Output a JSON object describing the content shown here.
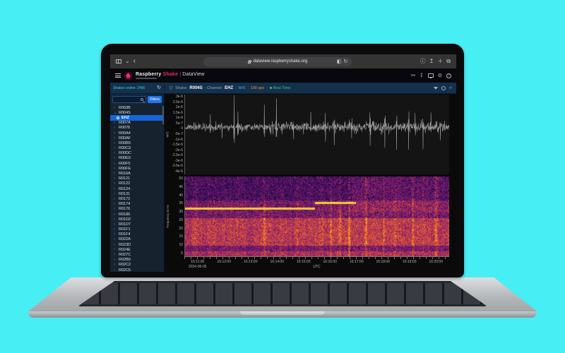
{
  "colors": {
    "background": "#47eef4",
    "accent_blue": "#2574e8",
    "cyan": "#35d0e8",
    "orange": "#f0953a",
    "green": "#2fd27d",
    "magenta": "#e8286e",
    "selection": "#1565d8",
    "waveform": "#9c9c9c"
  },
  "browser": {
    "url": "dataview.raspberryshake.org"
  },
  "header": {
    "brand_a": "Raspberry",
    "brand_b": "Shake",
    "sep": "|",
    "product": "DataView"
  },
  "toolbar": {
    "shakes_online": "Shakes online: 2466",
    "station_prefix": "Shake:",
    "station": "R004S",
    "channel_prefix": "- Channel:",
    "channel": "EHZ",
    "units": "M/S",
    "sps": "100 sps",
    "realtime": "Real Time"
  },
  "sidebar": {
    "filters": "Filters",
    "expanded_station": "R004S",
    "selected_channel": "EHZ",
    "stations": [
      "R003B",
      "R004S",
      "R007A",
      "R0076",
      "R00A4",
      "R00AF",
      "R00B9",
      "R00C3",
      "R00DC",
      "R00E0",
      "R00F5",
      "R00FE",
      "R016A",
      "R0121",
      "R0122",
      "R0124",
      "R0131",
      "R0172",
      "R0174",
      "R0176",
      "R0186",
      "R01D2",
      "R01D7",
      "R01F1",
      "R01F4",
      "R022A",
      "R023D",
      "R024E",
      "R027C",
      "R02B9",
      "R02C2",
      "R02C5"
    ]
  },
  "waveform": {
    "ylabel": "M/S",
    "yticks": [
      "3e-6",
      "2.5e-6",
      "2e-6",
      "1.5e-6",
      "1e-6",
      "5e-7",
      "0",
      "-5e-7",
      "-1e-6",
      "-1.5e-6",
      "-2e-6",
      "-2.5e-6",
      "-3e-6",
      "-3.5e-6",
      "-4e-6"
    ],
    "seed": 9
  },
  "spectrogram": {
    "ylabel": "Frequency in Hz",
    "yticks": [
      "50",
      "45",
      "40",
      "35",
      "30",
      "25",
      "20",
      "15",
      "10",
      "5"
    ],
    "seed": 23
  },
  "time_axis": {
    "utc": "UTC",
    "date": "2024-06-05",
    "ticks": [
      "16:11:00",
      "16:12:00",
      "16:13:00",
      "16:14:00",
      "16:15:00",
      "16:16:00",
      "16:17:00",
      "16:18:00",
      "16:19:00",
      "16:20:00"
    ]
  }
}
